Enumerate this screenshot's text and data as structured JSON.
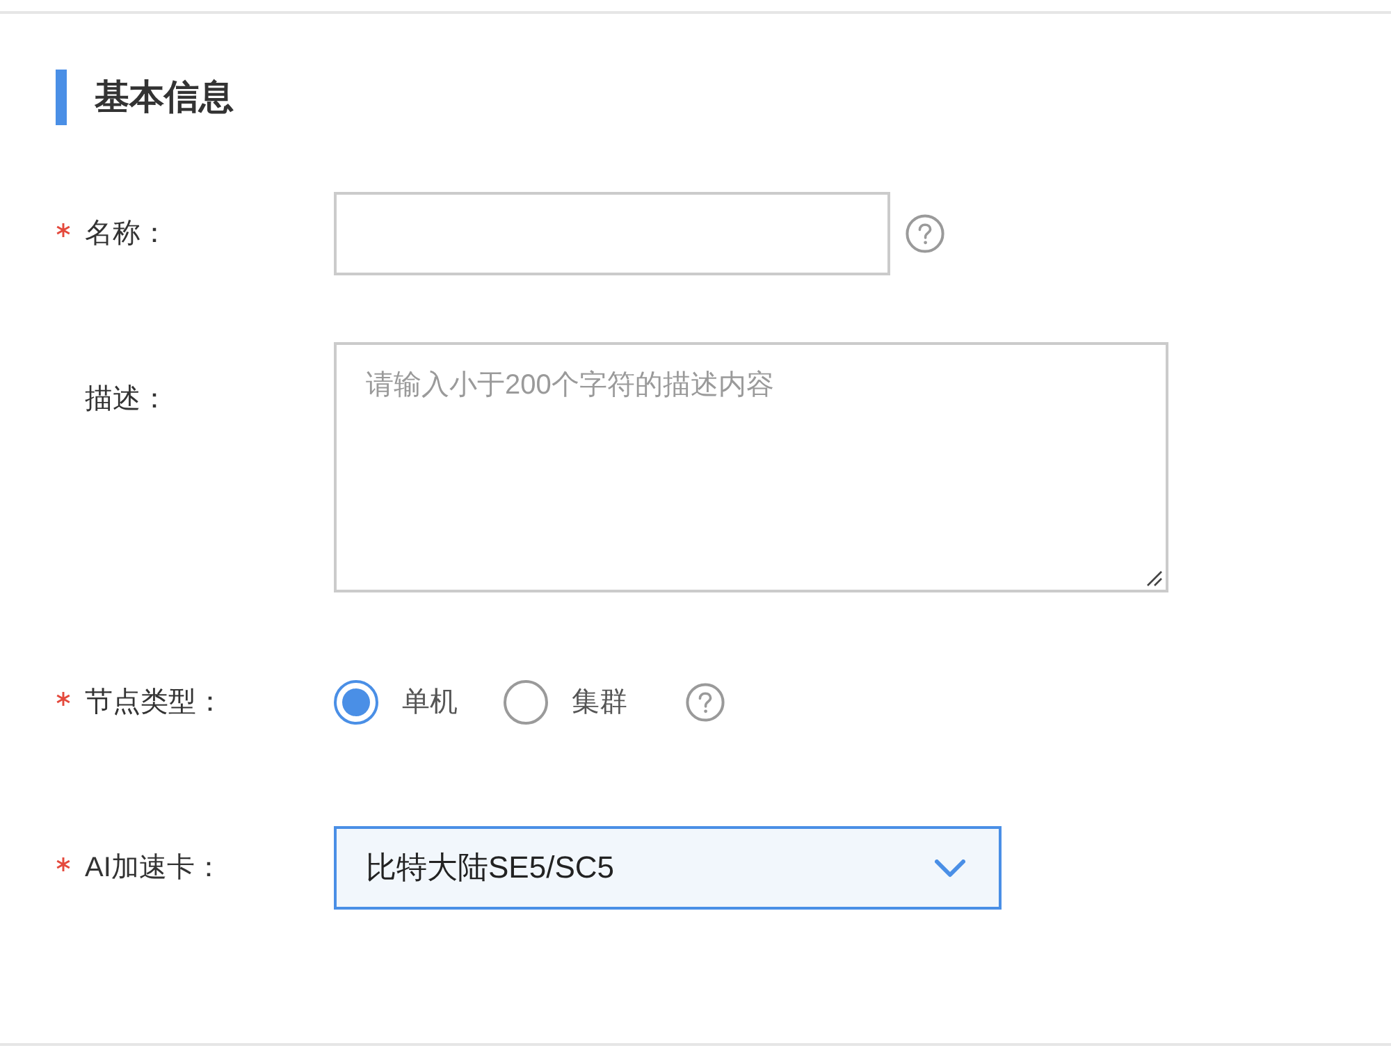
{
  "section": {
    "title": "基本信息"
  },
  "fields": [
    {
      "kind": "text",
      "label": "名称：",
      "required": true,
      "help": true,
      "focused": false
    },
    {
      "kind": "textarea",
      "label": "描述：",
      "required": false,
      "help": false,
      "focused": false,
      "placeholder": "请输入小于200个字符的描述内容"
    },
    {
      "kind": "radio",
      "label": "节点类型：",
      "required": true,
      "help": true,
      "options": [
        {
          "label": "单机",
          "selected": true
        },
        {
          "label": "集群",
          "selected": false
        }
      ]
    },
    {
      "kind": "select",
      "label": "AI加速卡：",
      "required": true,
      "help": false,
      "focused": true,
      "value": "比特大陆SE5/SC5"
    }
  ]
}
